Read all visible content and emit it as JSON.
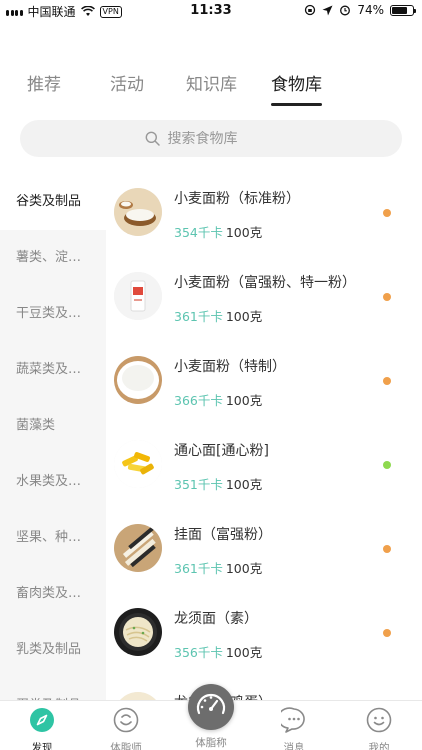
{
  "status_bar": {
    "carrier": "中国联通",
    "vpn": "VPN",
    "time": "11:33",
    "battery": "74%",
    "battery_level": 0.74
  },
  "tabs": [
    {
      "label": "推荐",
      "active": false
    },
    {
      "label": "活动",
      "active": false
    },
    {
      "label": "知识库",
      "active": false
    },
    {
      "label": "食物库",
      "active": true
    }
  ],
  "search": {
    "placeholder": "搜索食物库"
  },
  "categories": [
    {
      "label": "谷类及制品",
      "active": true
    },
    {
      "label": "薯类、淀粉及制品",
      "active": false
    },
    {
      "label": "干豆类及制品",
      "active": false
    },
    {
      "label": "蔬菜类及制品",
      "active": false
    },
    {
      "label": "菌藻类",
      "active": false
    },
    {
      "label": "水果类及制品",
      "active": false
    },
    {
      "label": "坚果、种子类",
      "active": false
    },
    {
      "label": "畜肉类及制品",
      "active": false
    },
    {
      "label": "乳类及制品",
      "active": false
    },
    {
      "label": "蛋类及制品",
      "active": false
    }
  ],
  "foods": [
    {
      "name": "小麦面粉（标准粉）",
      "kcal": "354千卡",
      "amount": "100克",
      "dot_color": "#f0a04b",
      "thumb": "flour-bowl"
    },
    {
      "name": "小麦面粉（富强粉、特一粉）",
      "kcal": "361千卡",
      "amount": "100克",
      "dot_color": "#f0a04b",
      "thumb": "flour-bag"
    },
    {
      "name": "小麦面粉（特制）",
      "kcal": "366千卡",
      "amount": "100克",
      "dot_color": "#f0a04b",
      "thumb": "flour-sack"
    },
    {
      "name": "通心面[通心粉]",
      "kcal": "351千卡",
      "amount": "100克",
      "dot_color": "#8ed94f",
      "thumb": "penne"
    },
    {
      "name": "挂面（富强粉）",
      "kcal": "361千卡",
      "amount": "100克",
      "dot_color": "#f0a04b",
      "thumb": "dry-noodles"
    },
    {
      "name": "龙须面（素）",
      "kcal": "356千卡",
      "amount": "100克",
      "dot_color": "#f0a04b",
      "thumb": "noodle-soup"
    },
    {
      "name": "龙须面（鸡蛋）",
      "kcal": "",
      "amount": "",
      "dot_color": "#f0a04b",
      "thumb": "egg-noodles"
    }
  ],
  "bottom_nav": [
    {
      "label": "发现",
      "icon": "compass-icon",
      "active": true
    },
    {
      "label": "体脂师",
      "icon": "coach-icon",
      "active": false
    },
    {
      "label": "体脂称",
      "icon": "scale-icon",
      "active": false
    },
    {
      "label": "消息",
      "icon": "message-icon",
      "active": false
    },
    {
      "label": "我的",
      "icon": "profile-icon",
      "active": false
    }
  ],
  "colors": {
    "accent": "#2ec4a4",
    "kcal": "#5cc4b0",
    "high_dot": "#f0a04b",
    "low_dot": "#8ed94f"
  }
}
